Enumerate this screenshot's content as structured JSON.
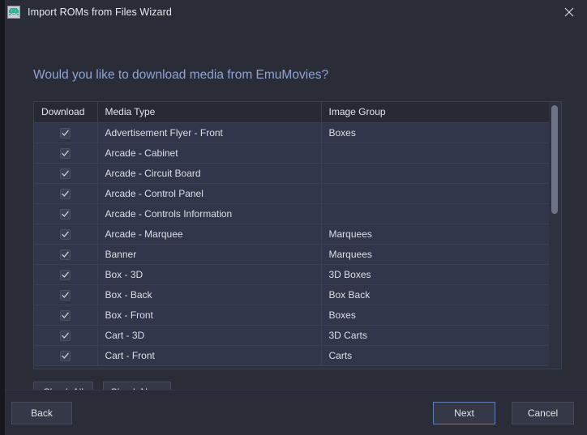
{
  "window": {
    "title": "Import ROMs from Files Wizard",
    "app_icon": "space-invader-icon",
    "close_label": "×"
  },
  "heading": "Would you like to download media from EmuMovies?",
  "table": {
    "columns": [
      "Download",
      "Media Type",
      "Image Group"
    ],
    "rows": [
      {
        "checked": "checked",
        "media_type": "Advertisement Flyer - Front",
        "image_group": "Boxes"
      },
      {
        "checked": "checked",
        "media_type": "Arcade - Cabinet",
        "image_group": ""
      },
      {
        "checked": "checked",
        "media_type": "Arcade - Circuit Board",
        "image_group": ""
      },
      {
        "checked": "checked",
        "media_type": "Arcade - Control Panel",
        "image_group": ""
      },
      {
        "checked": "checked",
        "media_type": "Arcade - Controls Information",
        "image_group": ""
      },
      {
        "checked": "checked",
        "media_type": "Arcade - Marquee",
        "image_group": "Marquees"
      },
      {
        "checked": "checked",
        "media_type": "Banner",
        "image_group": "Marquees"
      },
      {
        "checked": "checked",
        "media_type": "Box - 3D",
        "image_group": "3D Boxes"
      },
      {
        "checked": "checked",
        "media_type": "Box - Back",
        "image_group": "Box Back"
      },
      {
        "checked": "checked",
        "media_type": "Box - Front",
        "image_group": "Boxes"
      },
      {
        "checked": "checked",
        "media_type": "Cart - 3D",
        "image_group": "3D Carts"
      },
      {
        "checked": "checked",
        "media_type": "Cart - Front",
        "image_group": "Carts"
      }
    ]
  },
  "check_buttons": {
    "check_all": "Check All",
    "check_none": "Check None"
  },
  "footer": {
    "back": "Back",
    "next": "Next",
    "cancel": "Cancel"
  },
  "colors": {
    "window_bg": "#2a2d38",
    "heading": "#8fa4d4",
    "row_bg": "#32364a",
    "header_bg": "#272a35",
    "grid_line": "#3c4152",
    "button_bg": "#353947",
    "default_button_border": "#5b7fb5",
    "scrollbar_thumb": "#6d7287",
    "icon_accent": "#43c9a8"
  }
}
